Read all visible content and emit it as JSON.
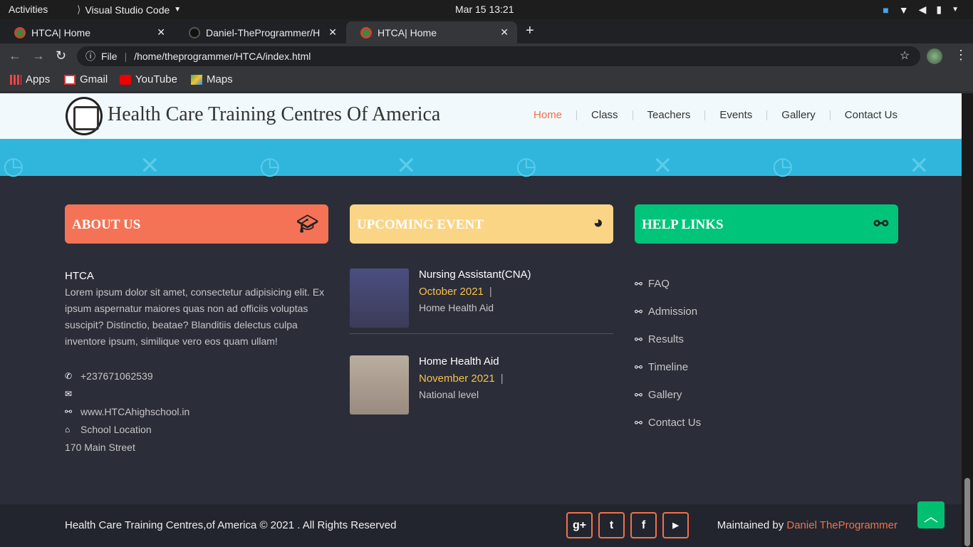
{
  "system": {
    "activities": "Activities",
    "app": "Visual Studio Code",
    "clock": "Mar 15  13:21"
  },
  "tabs": [
    {
      "label": "HTCA| Home"
    },
    {
      "label": "Daniel-TheProgrammer/H"
    },
    {
      "label": "HTCA| Home"
    }
  ],
  "address": {
    "scheme": "File",
    "url": "/home/theprogrammer/HTCA/index.html"
  },
  "bookmarks": [
    "Apps",
    "Gmail",
    "YouTube",
    "Maps"
  ],
  "site": {
    "title": "Health Care Training Centres Of America",
    "menu": [
      "Home",
      "Class",
      "Teachers",
      "Events",
      "Gallery",
      "Contact Us"
    ]
  },
  "about": {
    "heading": "ABOUT US",
    "name": "HTCA",
    "text": "Lorem ipsum dolor sit amet, consectetur adipisicing elit. Ex ipsum aspernatur maiores quas non ad officiis voluptas suscipit? Distinctio, beatae? Blanditiis delectus culpa inventore ipsum, similique vero eos quam ullam!",
    "phone": "+237671062539",
    "email": "",
    "website": "www.HTCAhighschool.in",
    "location": "School Location",
    "street": "170 Main Street"
  },
  "events": {
    "heading": "UPCOMING EVENT",
    "items": [
      {
        "title": "Nursing Assistant(CNA)",
        "date": "October 2021",
        "level": "Home Health Aid"
      },
      {
        "title": "Home Health Aid",
        "date": "November 2021",
        "level": "National level"
      }
    ]
  },
  "help": {
    "heading": "HELP LINKS",
    "links": [
      "FAQ",
      "Admission",
      "Results",
      "Timeline",
      "Gallery",
      "Contact Us"
    ]
  },
  "footer": {
    "copyright": "Health Care Training Centres,of America © 2021 . All Rights Reserved",
    "maintained": "Maintained by",
    "author": "Daniel TheProgrammer"
  },
  "colors": {
    "about": "#f47356",
    "event": "#fbd586",
    "help": "#00c47a",
    "accent": "#f0714a",
    "banner": "#30b6dd"
  }
}
